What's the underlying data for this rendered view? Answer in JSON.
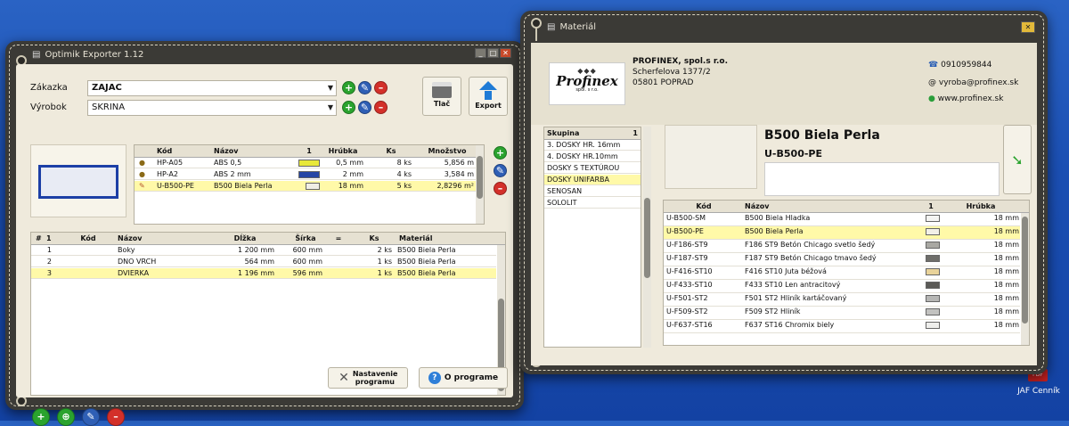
{
  "optimik": {
    "title": "Optimik Exporter 1.12",
    "zakazka_label": "Zákazka",
    "zakazka_value": "ZAJAC",
    "vyrobok_label": "Výrobok",
    "vyrobok_value": "SKRINA",
    "print_label": "Tlač",
    "export_label": "Export",
    "edges": {
      "headers": [
        "Kód",
        "Názov",
        "1",
        "Hrúbka",
        "Ks",
        "Množstvo"
      ],
      "rows": [
        {
          "kod": "HP-A05",
          "nazov": "ABS 0,5",
          "hrubka": "0,5 mm",
          "ks": "8 ks",
          "mnozstvo": "5,856 m",
          "swatch": "#e8e83a",
          "sel": false
        },
        {
          "kod": "HP-A2",
          "nazov": "ABS 2 mm",
          "hrubka": "2 mm",
          "ks": "4 ks",
          "mnozstvo": "3,584 m",
          "swatch": "#2545a5",
          "sel": false
        },
        {
          "kod": "U-B500-PE",
          "nazov": "B500 Biela Perla",
          "hrubka": "18 mm",
          "ks": "5 ks",
          "mnozstvo": "2,8296 m²",
          "swatch": "#f0eee6",
          "sel": true
        }
      ]
    },
    "parts": {
      "headers": [
        "#",
        "1",
        "Kód",
        "Názov",
        "Dĺžka",
        "Šírka",
        "=",
        "Ks",
        "Materiál"
      ],
      "rows": [
        {
          "n": "1",
          "kod": "",
          "nazov": "Boky",
          "dlzka": "1 200 mm",
          "sirka": "600 mm",
          "ks": "2 ks",
          "mat": "B500 Biela Perla",
          "sel": false
        },
        {
          "n": "2",
          "kod": "",
          "nazov": "DNO VRCH",
          "dlzka": "564 mm",
          "sirka": "600 mm",
          "ks": "1 ks",
          "mat": "B500 Biela Perla",
          "sel": false
        },
        {
          "n": "3",
          "kod": "",
          "nazov": "DVIERKA",
          "dlzka": "1 196 mm",
          "sirka": "596 mm",
          "ks": "1 ks",
          "mat": "B500 Biela Perla",
          "sel": true
        }
      ]
    },
    "settings_label": "Nastavenie programu",
    "about_label": "O programe"
  },
  "material": {
    "title": "Materiál",
    "company": {
      "name": "PROFINEX, spol.s r.o.",
      "street": "Scherfelova 1377/2",
      "city": "05801  POPRAD",
      "phone": "0910959844",
      "email": "vyroba@profinex.sk",
      "web": "www.profinex.sk",
      "logo": "Profinex",
      "logo_sub": "spol. s r.o."
    },
    "groups_header": "Skupina",
    "groups_sort": "1",
    "groups": [
      "3. DOSKY HR. 16mm",
      "4. DOSKY HR.10mm",
      "DOSKY S TEXTÚROU",
      "DOSKY UNIFARBA",
      "SENOSAN",
      "SOLOLIT"
    ],
    "selected_group": 3,
    "selected_name": "B500 Biela Perla",
    "selected_code": "U-B500-PE",
    "list_headers": [
      "Kód",
      "Názov",
      "1",
      "Hrúbka"
    ],
    "items": [
      {
        "kod": "U-B500-SM",
        "nazov": "B500 Biela Hladka",
        "h": "18 mm",
        "c": "#f4f4f2",
        "sel": false
      },
      {
        "kod": "U-B500-PE",
        "nazov": "B500 Biela Perla",
        "h": "18 mm",
        "c": "#f2f0e8",
        "sel": true
      },
      {
        "kod": "U-F186-ST9",
        "nazov": "F186 ST9 Betón Chicago svetlo šedý",
        "h": "18 mm",
        "c": "#a9a8a3",
        "sel": false
      },
      {
        "kod": "U-F187-ST9",
        "nazov": "F187 ST9 Betón Chicago tmavo šedý",
        "h": "18 mm",
        "c": "#6e6d69",
        "sel": false
      },
      {
        "kod": "U-F416-ST10",
        "nazov": "F416 ST10 Juta béžová",
        "h": "18 mm",
        "c": "#e9d39a",
        "sel": false
      },
      {
        "kod": "U-F433-ST10",
        "nazov": "F433 ST10 Len antracitový",
        "h": "18 mm",
        "c": "#5b5a57",
        "sel": false
      },
      {
        "kod": "U-F501-ST2",
        "nazov": "F501 ST2 Hliník kartáčovaný",
        "h": "18 mm",
        "c": "#b6b6b4",
        "sel": false
      },
      {
        "kod": "U-F509-ST2",
        "nazov": "F509 ST2 Hliník",
        "h": "18 mm",
        "c": "#c2c2c0",
        "sel": false
      },
      {
        "kod": "U-F637-ST16",
        "nazov": "F637 ST16 Chromix biely",
        "h": "18 mm",
        "c": "#eeeeec",
        "sel": false
      }
    ]
  },
  "desktop": {
    "icon_label": "JAF Cenník",
    "pdf": "PDF"
  }
}
